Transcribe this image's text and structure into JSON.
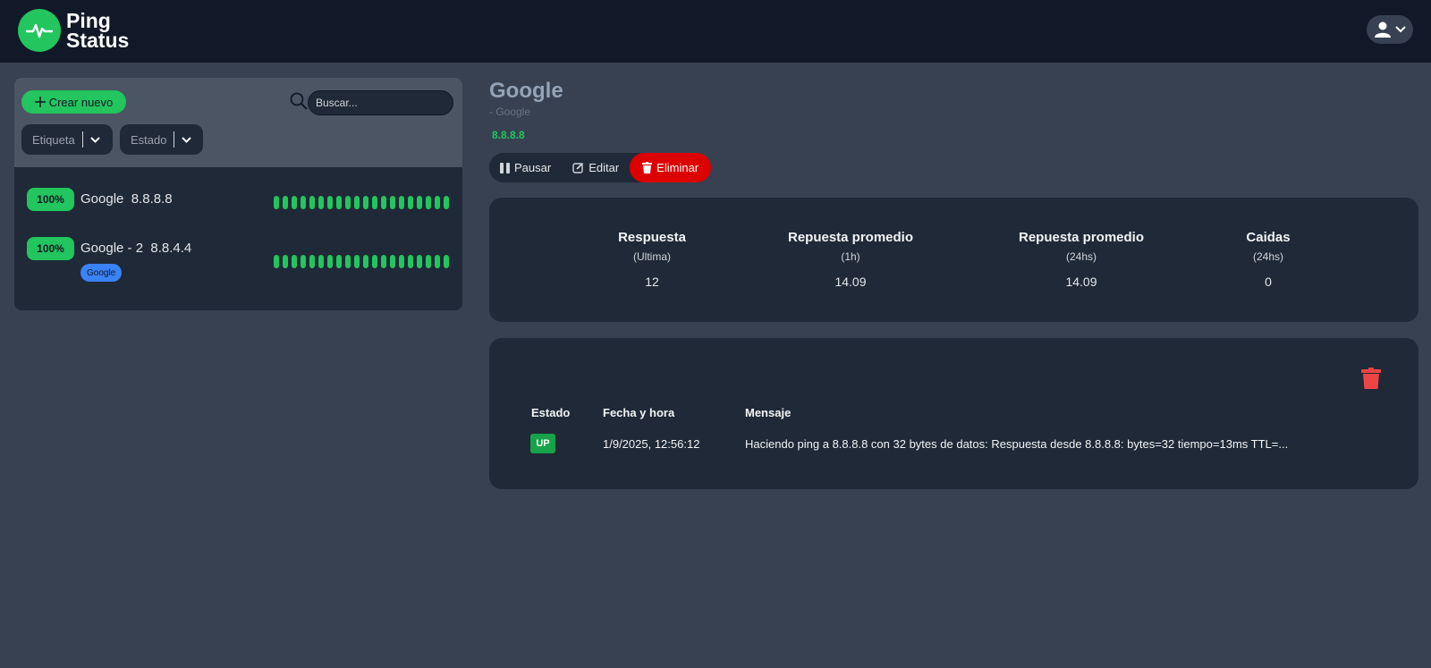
{
  "app": {
    "logo_line1": "Ping",
    "logo_line2": "Status",
    "brand_color": "#22c55e"
  },
  "sidebar": {
    "create_label": "Crear nuevo",
    "search_placeholder": "Buscar...",
    "filter_tag_label": "Etiqueta",
    "filter_status_label": "Estado",
    "monitors": [
      {
        "percent": "100%",
        "name": "Google",
        "host": "8.8.8.8",
        "tag": "",
        "beats": 20
      },
      {
        "percent": "100%",
        "name": "Google - 2",
        "host": "8.8.4.4",
        "tag": "Google",
        "beats": 20
      }
    ]
  },
  "detail": {
    "title": "Google",
    "subtitle": "- Google",
    "host": "8.8.8.8",
    "actions": {
      "pause": "Pausar",
      "edit": "Editar",
      "delete": "Eliminar"
    }
  },
  "stats": [
    {
      "title": "Respuesta",
      "sub": "(Ultima)",
      "value": "12"
    },
    {
      "title": "Repuesta promedio",
      "sub": "(1h)",
      "value": "14.09"
    },
    {
      "title": "Repuesta promedio",
      "sub": "(24hs)",
      "value": "14.09"
    },
    {
      "title": "Caidas",
      "sub": "(24hs)",
      "value": "0"
    }
  ],
  "events": {
    "headers": {
      "status": "Estado",
      "datetime": "Fecha y hora",
      "message": "Mensaje"
    },
    "rows": [
      {
        "status": "UP",
        "datetime": "1/9/2025, 12:56:12",
        "message": "Haciendo ping a 8.8.8.8 con 32 bytes de datos: Respuesta desde 8.8.8.8: bytes=32 tiempo=13ms TTL=..."
      }
    ]
  }
}
